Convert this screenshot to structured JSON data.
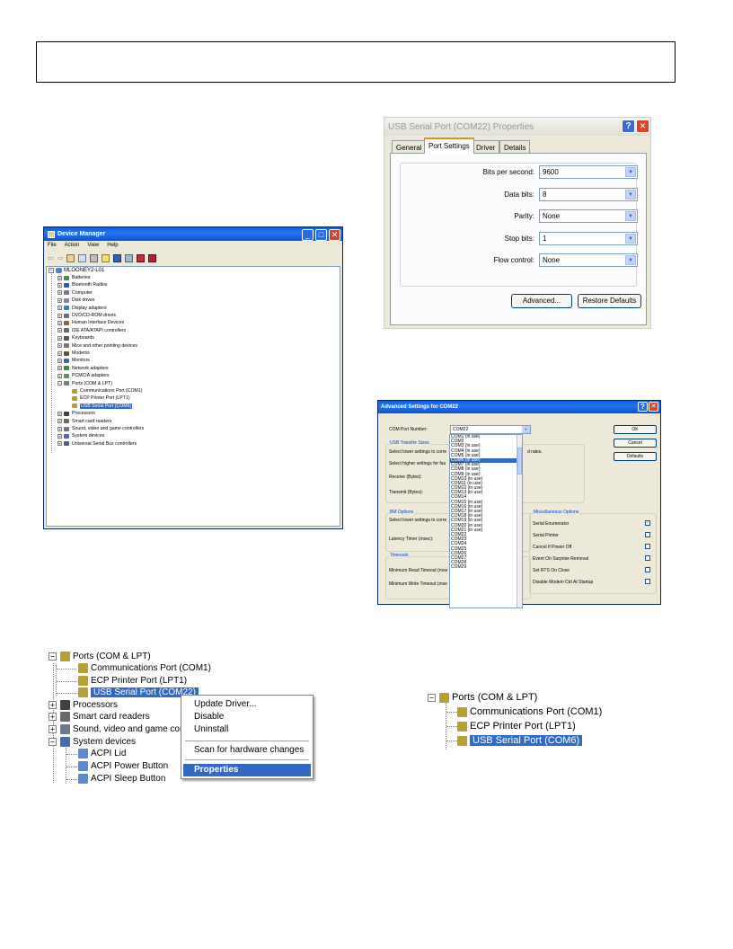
{
  "colors": {
    "xp_blue": "#0a5ee0",
    "selection": "#316ac5",
    "dialog_bg": "#ece9d8",
    "close_red": "#d8462a"
  },
  "device_manager": {
    "title": "Device Manager",
    "menu": [
      "File",
      "Action",
      "View",
      "Help"
    ],
    "root": "MLOONEY2-L01",
    "items": [
      "Batteries",
      "Bluetooth Radios",
      "Computer",
      "Disk drives",
      "Display adapters",
      "DVD/CD-ROM drives",
      "Human Interface Devices",
      "IDE ATA/ATAPI controllers",
      "Keyboards",
      "Mice and other pointing devices",
      "Modems",
      "Monitors",
      "Network adapters",
      "PCMCIA adapters",
      "Ports (COM & LPT)"
    ],
    "ports_children": [
      "Communications Port (COM1)",
      "ECP Printer Port (LPT1)",
      "USB Serial Port (COM6)"
    ],
    "after_items": [
      "Processors",
      "Smart card readers",
      "Sound, video and game controllers",
      "System devices",
      "Universal Serial Bus controllers"
    ]
  },
  "props": {
    "title": "USB Serial Port (COM22) Properties",
    "help": "?",
    "close": "✕",
    "tabs": [
      "General",
      "Port Settings",
      "Driver",
      "Details"
    ],
    "fields": [
      {
        "label": "Bits per second:",
        "value": "9600"
      },
      {
        "label": "Data bits:",
        "value": "8"
      },
      {
        "label": "Parity:",
        "value": "None"
      },
      {
        "label": "Stop bits:",
        "value": "1"
      },
      {
        "label": "Flow control:",
        "value": "None"
      }
    ],
    "advanced": "Advanced...",
    "restore": "Restore Defaults"
  },
  "adv": {
    "title": "Advanced Settings for COM22",
    "help": "?",
    "close": "✕",
    "com_port_label": "COM Port Number:",
    "com_port_value": "COM22",
    "usb_group": "USB Transfer Sizes",
    "usb_line1": "Select lower settings to corre",
    "usb_line1_tail": "d rates.",
    "usb_line2": "Select higher settings for fas",
    "receive": "Receive (Bytes):",
    "transmit": "Transmit (Bytes):",
    "bm_group": "BM Options",
    "bm_line": "Select lower settings to corre",
    "latency": "Latency Timer (msec):",
    "timeouts_group": "Timeouts",
    "min_read": "Minimum Read Timeout (mse",
    "min_write": "Minimum Write Timeout (mse",
    "misc_group": "Miscellaneous Options",
    "misc": [
      {
        "label": "Serial Enumerator",
        "checked": true,
        "mark": "✓"
      },
      {
        "label": "Serial Printer",
        "checked": false,
        "mark": ""
      },
      {
        "label": "Cancel If Power Off",
        "checked": false,
        "mark": ""
      },
      {
        "label": "Event On Surprise Removal",
        "checked": false,
        "mark": ""
      },
      {
        "label": "Set RTS On Close",
        "checked": false,
        "mark": ""
      },
      {
        "label": "Disable Modem Ctrl At Startup",
        "checked": false,
        "mark": ""
      }
    ],
    "ok": "OK",
    "cancel": "Cancel",
    "defaults": "Defaults",
    "com_list": [
      "COM1 (in use)",
      "COM2",
      "COM3 (in use)",
      "COM4 (in use)",
      "COM5 (in use)",
      "COM6 (in use)",
      "COM7 (in use)",
      "COM8 (in use)",
      "COM9 (in use)",
      "COM10 (in use)",
      "COM11 (in use)",
      "COM12 (in use)",
      "COM13 (in use)",
      "COM14",
      "COM15 (in use)",
      "COM16 (in use)",
      "COM17 (in use)",
      "COM18 (in use)",
      "COM19 (in use)",
      "COM20 (in use)",
      "COM21 (in use)",
      "COM22",
      "COM23",
      "COM24",
      "COM25",
      "COM26",
      "COM27",
      "COM28",
      "COM29"
    ],
    "highlight_index": 5
  },
  "tree_left": {
    "ports": "Ports (COM & LPT)",
    "children": [
      "Communications Port (COM1)",
      "ECP Printer Port (LPT1)",
      "USB Serial Port (COM22)"
    ],
    "after": [
      "Processors",
      "Smart card readers",
      "Sound, video and game con",
      "System devices"
    ],
    "system_children": [
      "ACPI Lid",
      "ACPI Power Button",
      "ACPI Sleep Button"
    ]
  },
  "context_menu": [
    "Update Driver...",
    "Disable",
    "Uninstall",
    "Scan for hardware changes",
    "Properties"
  ],
  "tree_right": {
    "ports": "Ports (COM & LPT)",
    "children": [
      "Communications Port (COM1)",
      "ECP Printer Port (LPT1)",
      "USB Serial Port (COM6)"
    ]
  }
}
